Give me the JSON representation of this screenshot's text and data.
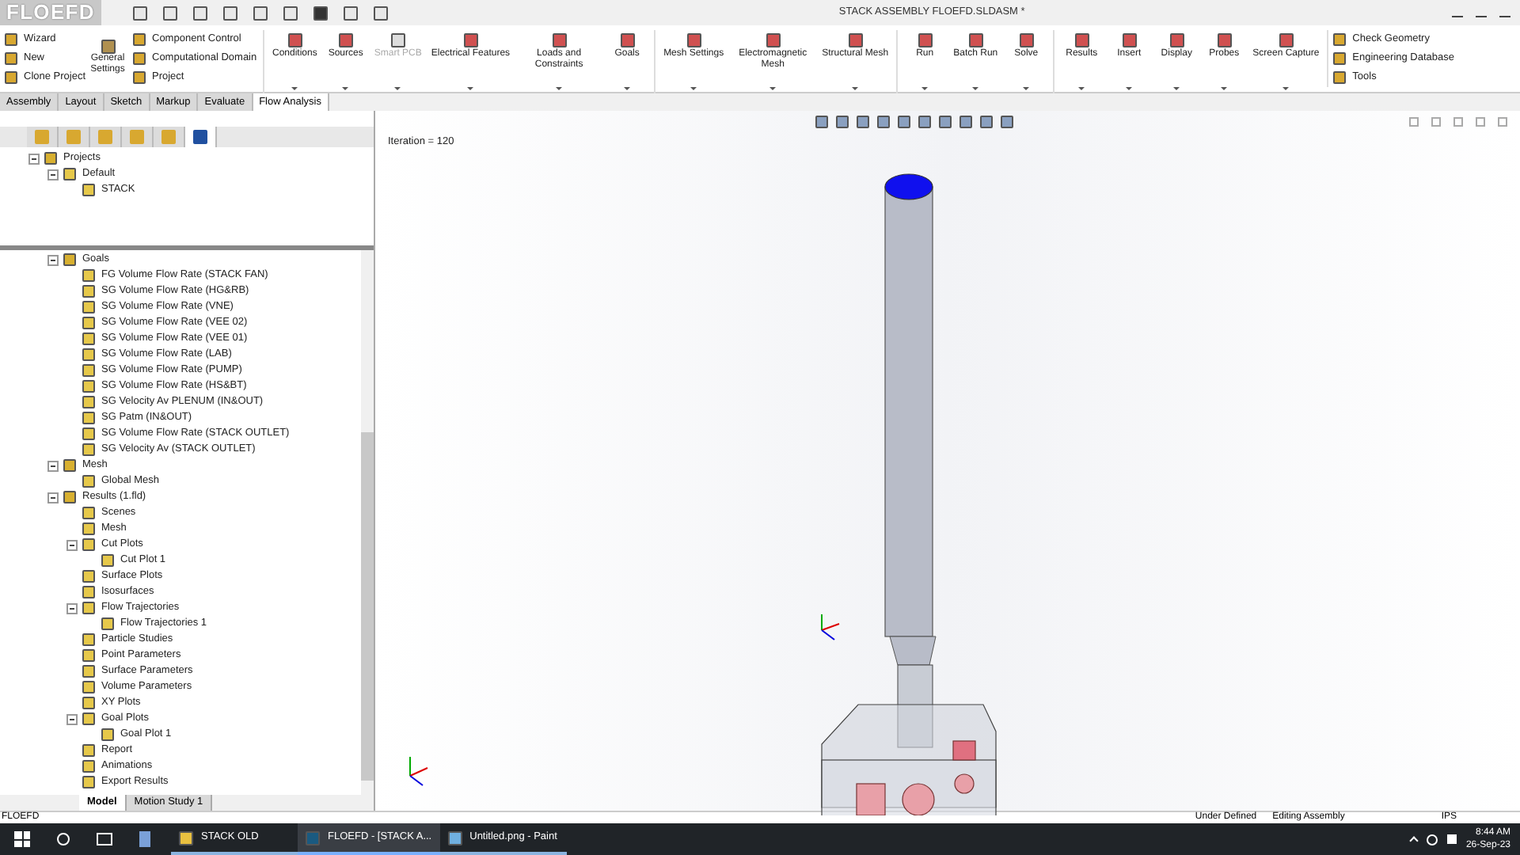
{
  "app": {
    "logo": "FLOEFD",
    "title": "STACK ASSEMBLY FLOEFD.SLDASM *"
  },
  "ribbon": {
    "small_left": [
      "Wizard",
      "New",
      "Clone Project"
    ],
    "general": "General Settings",
    "small_mid": [
      "Component Control",
      "Computational Domain",
      "Project"
    ],
    "groups": [
      [
        {
          "label": "Conditions",
          "disabled": false
        },
        {
          "label": "Sources",
          "disabled": false
        },
        {
          "label": "Smart PCB",
          "disabled": true
        },
        {
          "label": "Electrical Features",
          "disabled": false
        },
        {
          "label": "Loads and Constraints",
          "disabled": false
        },
        {
          "label": "Goals",
          "disabled": false
        }
      ],
      [
        {
          "label": "Mesh Settings",
          "disabled": false
        },
        {
          "label": "Electromagnetic Mesh",
          "disabled": false
        },
        {
          "label": "Structural Mesh",
          "disabled": false
        }
      ],
      [
        {
          "label": "Run",
          "disabled": false
        },
        {
          "label": "Batch Run",
          "disabled": false
        },
        {
          "label": "Solve",
          "disabled": false
        }
      ],
      [
        {
          "label": "Results",
          "disabled": false
        },
        {
          "label": "Insert",
          "disabled": false
        },
        {
          "label": "Display",
          "disabled": false
        },
        {
          "label": "Probes",
          "disabled": false
        },
        {
          "label": "Screen Capture",
          "disabled": false
        }
      ]
    ],
    "small_right": [
      "Check Geometry",
      "Engineering Database",
      "Tools"
    ]
  },
  "tabs": [
    {
      "label": "Assembly",
      "selected": false
    },
    {
      "label": "Layout",
      "selected": false
    },
    {
      "label": "Sketch",
      "selected": false
    },
    {
      "label": "Markup",
      "selected": false
    },
    {
      "label": "Evaluate",
      "selected": false
    },
    {
      "label": "Flow Analysis",
      "selected": true
    }
  ],
  "panel_tabs": [
    {
      "selected": false
    },
    {
      "selected": false
    },
    {
      "selected": false
    },
    {
      "selected": false
    },
    {
      "selected": false
    },
    {
      "selected": true
    }
  ],
  "projects_tree": [
    {
      "label": "Projects",
      "expanded": true,
      "children": [
        {
          "label": "Default",
          "expanded": true,
          "children": [
            {
              "label": "STACK"
            }
          ]
        }
      ]
    }
  ],
  "analysis_tree": [
    {
      "label": "Goals",
      "expanded": true,
      "children": [
        {
          "label": "FG Volume Flow Rate (STACK FAN)"
        },
        {
          "label": "SG Volume Flow Rate (HG&RB)"
        },
        {
          "label": "SG Volume Flow Rate (VNE)"
        },
        {
          "label": "SG Volume Flow Rate (VEE 02)"
        },
        {
          "label": "SG Volume Flow Rate (VEE 01)"
        },
        {
          "label": "SG Volume Flow Rate (LAB)"
        },
        {
          "label": "SG Volume Flow Rate (PUMP)"
        },
        {
          "label": "SG Volume Flow Rate (HS&BT)"
        },
        {
          "label": "SG  Velocity Av PLENUM (IN&OUT)"
        },
        {
          "label": "SG Patm (IN&OUT)"
        },
        {
          "label": "SG Volume Flow Rate (STACK OUTLET)"
        },
        {
          "label": "SG Velocity Av (STACK OUTLET)"
        }
      ]
    },
    {
      "label": "Mesh",
      "expanded": true,
      "children": [
        {
          "label": "Global Mesh"
        }
      ]
    },
    {
      "label": "Results (1.fld)",
      "expanded": true,
      "children": [
        {
          "label": "Scenes"
        },
        {
          "label": "Mesh"
        },
        {
          "label": "Cut Plots",
          "expanded": true,
          "children": [
            {
              "label": "Cut Plot 1"
            }
          ]
        },
        {
          "label": "Surface Plots"
        },
        {
          "label": "Isosurfaces"
        },
        {
          "label": "Flow Trajectories",
          "expanded": true,
          "children": [
            {
              "label": "Flow Trajectories 1"
            }
          ]
        },
        {
          "label": "Particle Studies"
        },
        {
          "label": "Point Parameters"
        },
        {
          "label": "Surface Parameters"
        },
        {
          "label": "Volume Parameters"
        },
        {
          "label": "XY Plots"
        },
        {
          "label": "Goal Plots",
          "expanded": true,
          "children": [
            {
              "label": "Goal Plot 1"
            }
          ]
        },
        {
          "label": "Report"
        },
        {
          "label": "Animations"
        },
        {
          "label": "Export Results"
        }
      ]
    }
  ],
  "bottom_tabs": [
    {
      "label": "Model",
      "selected": true
    },
    {
      "label": "Motion Study 1",
      "selected": false
    }
  ],
  "viewport": {
    "iteration": "Iteration = 120"
  },
  "status_bar": {
    "app": "FLOEFD",
    "state": "Under Defined",
    "mode": "Editing Assembly",
    "units": "IPS"
  },
  "taskbar": {
    "apps": [
      {
        "label": "STACK OLD",
        "active": false
      },
      {
        "label": "FLOEFD - [STACK A...",
        "active": true
      },
      {
        "label": "Untitled.png - Paint",
        "active": false
      }
    ],
    "time": "8:44 AM",
    "date": "26-Sep-23"
  }
}
